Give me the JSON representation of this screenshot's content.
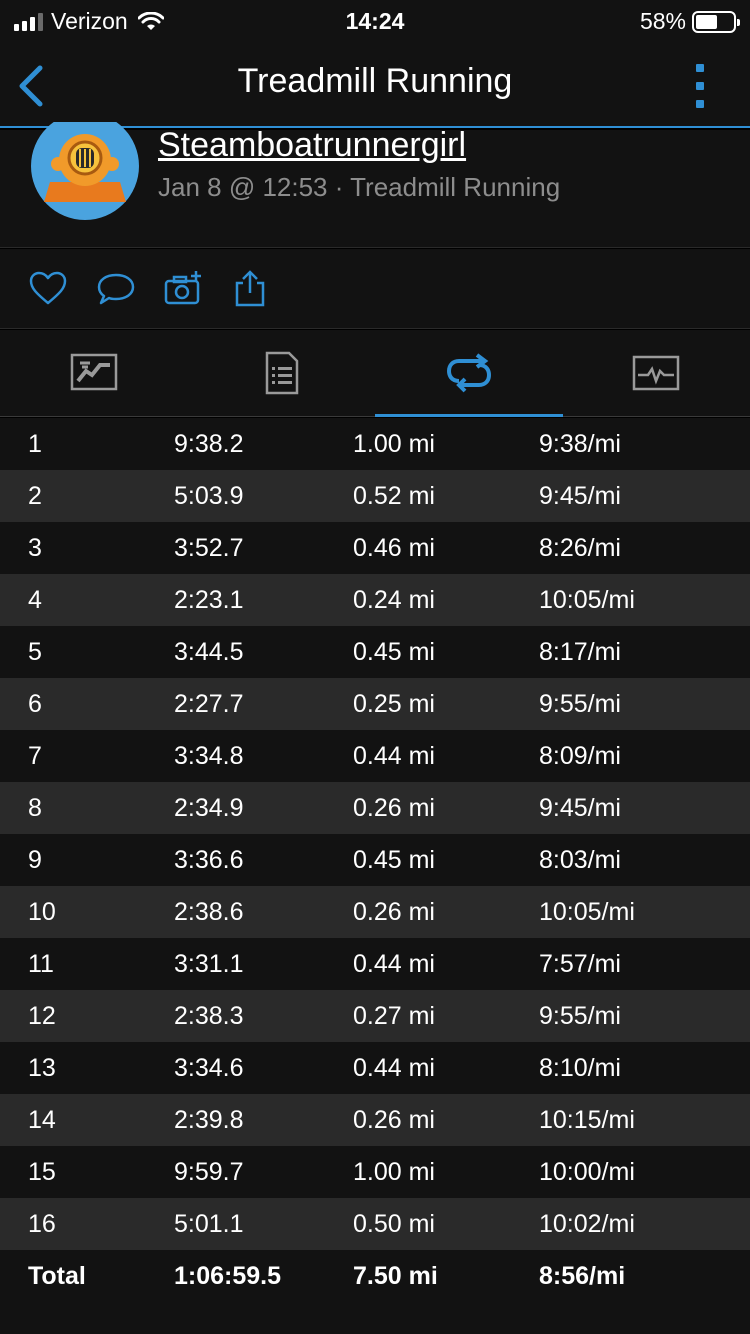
{
  "status_bar": {
    "carrier": "Verizon",
    "time": "14:24",
    "battery_percent": "58%",
    "battery_level": 0.58
  },
  "nav": {
    "title": "Treadmill Running",
    "back_icon": "chevron-left-icon",
    "more_icon": "more-vertical-icon"
  },
  "profile": {
    "username": "Steamboatrunnergirl",
    "meta": "Jan 8 @ 12:53 · Treadmill Running"
  },
  "actions": [
    "heart-icon",
    "comment-icon",
    "add-photo-icon",
    "share-icon"
  ],
  "tabs": [
    {
      "icon": "map-icon",
      "active": false
    },
    {
      "icon": "details-icon",
      "active": false
    },
    {
      "icon": "laps-icon",
      "active": true
    },
    {
      "icon": "chart-icon",
      "active": false
    }
  ],
  "laps": [
    {
      "lap": "1",
      "time": "9:38.2",
      "distance": "1.00 mi",
      "pace": "9:38/mi"
    },
    {
      "lap": "2",
      "time": "5:03.9",
      "distance": "0.52 mi",
      "pace": "9:45/mi"
    },
    {
      "lap": "3",
      "time": "3:52.7",
      "distance": "0.46 mi",
      "pace": "8:26/mi"
    },
    {
      "lap": "4",
      "time": "2:23.1",
      "distance": "0.24 mi",
      "pace": "10:05/mi"
    },
    {
      "lap": "5",
      "time": "3:44.5",
      "distance": "0.45 mi",
      "pace": "8:17/mi"
    },
    {
      "lap": "6",
      "time": "2:27.7",
      "distance": "0.25 mi",
      "pace": "9:55/mi"
    },
    {
      "lap": "7",
      "time": "3:34.8",
      "distance": "0.44 mi",
      "pace": "8:09/mi"
    },
    {
      "lap": "8",
      "time": "2:34.9",
      "distance": "0.26 mi",
      "pace": "9:45/mi"
    },
    {
      "lap": "9",
      "time": "3:36.6",
      "distance": "0.45 mi",
      "pace": "8:03/mi"
    },
    {
      "lap": "10",
      "time": "2:38.6",
      "distance": "0.26 mi",
      "pace": "10:05/mi"
    },
    {
      "lap": "11",
      "time": "3:31.1",
      "distance": "0.44 mi",
      "pace": "7:57/mi"
    },
    {
      "lap": "12",
      "time": "2:38.3",
      "distance": "0.27 mi",
      "pace": "9:55/mi"
    },
    {
      "lap": "13",
      "time": "3:34.6",
      "distance": "0.44 mi",
      "pace": "8:10/mi"
    },
    {
      "lap": "14",
      "time": "2:39.8",
      "distance": "0.26 mi",
      "pace": "10:15/mi"
    },
    {
      "lap": "15",
      "time": "9:59.7",
      "distance": "1.00 mi",
      "pace": "10:00/mi"
    },
    {
      "lap": "16",
      "time": "5:01.1",
      "distance": "0.50 mi",
      "pace": "10:02/mi"
    }
  ],
  "total": {
    "label": "Total",
    "time": "1:06:59.5",
    "distance": "7.50 mi",
    "pace": "8:56/mi"
  },
  "colors": {
    "accent": "#2f8fd4",
    "background": "#121212",
    "row_alt": "#2a2a2a"
  }
}
